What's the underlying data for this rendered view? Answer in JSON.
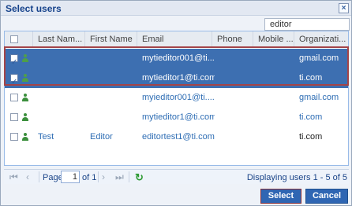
{
  "dialog": {
    "title": "Select users",
    "close_icon": "close-icon"
  },
  "search": {
    "value": "editor",
    "placeholder": ""
  },
  "columns": [
    {
      "label": "Last Nam..."
    },
    {
      "label": "First Name"
    },
    {
      "label": "Email"
    },
    {
      "label": "Phone"
    },
    {
      "label": "Mobile ..."
    },
    {
      "label": "Organizati..."
    }
  ],
  "rows": [
    {
      "checked": true,
      "selected": true,
      "last_name": "",
      "first_name": "",
      "email": "mytieditor001@ti....",
      "phone": "",
      "mobile": "",
      "organization": "gmail.com",
      "email_link": true,
      "organization_link": false
    },
    {
      "checked": true,
      "selected": true,
      "last_name": "",
      "first_name": "",
      "email": "mytieditor1@ti.com",
      "phone": "",
      "mobile": "",
      "organization": "ti.com",
      "email_link": true,
      "organization_link": false
    },
    {
      "checked": false,
      "selected": false,
      "last_name": "",
      "first_name": "",
      "email": "myieditor001@ti....",
      "phone": "",
      "mobile": "",
      "organization": "gmail.com",
      "email_link": true,
      "organization_link": true
    },
    {
      "checked": false,
      "selected": false,
      "last_name": "",
      "first_name": "",
      "email": "mytieditor1@ti.com",
      "phone": "",
      "mobile": "",
      "organization": "ti.com",
      "email_link": true,
      "organization_link": true
    },
    {
      "checked": false,
      "selected": false,
      "last_name": "Test",
      "first_name": "Editor",
      "email": "editortest1@ti.com",
      "phone": "",
      "mobile": "",
      "organization": "ti.com",
      "email_link": true,
      "organization_link": false
    }
  ],
  "pager": {
    "first_icon": "first-page-icon",
    "prev_icon": "prev-page-icon",
    "page_label": "Page",
    "page_value": "1",
    "of_label": "of 1",
    "next_icon": "next-page-icon",
    "last_icon": "last-page-icon",
    "refresh_icon": "refresh-icon",
    "displaying_text": "Displaying users 1 - 5 of 5"
  },
  "footer": {
    "select_label": "Select",
    "cancel_label": "Cancel"
  },
  "colors": {
    "selected_row_bg": "#3d6fb1",
    "accent_blue": "#2f66b3",
    "link_blue": "#2e6db4",
    "user_icon_green": "#3b8f3c",
    "selection_outline": "#a44448"
  }
}
